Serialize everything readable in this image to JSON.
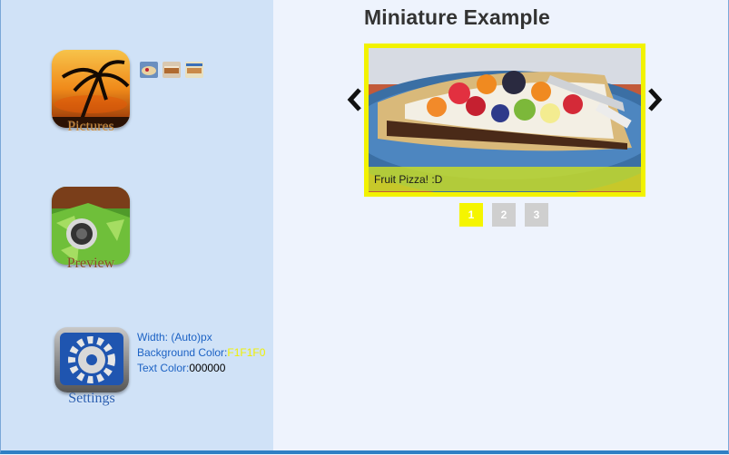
{
  "sidebar": {
    "apps": [
      {
        "label": "Pictures"
      },
      {
        "label": "Preview"
      },
      {
        "label": "Settings"
      }
    ],
    "settings": {
      "width_label": "Width:",
      "width_value": "(Auto)px",
      "background_label": "Background Color:",
      "background_value": "F1F1F0",
      "text_color_label": "Text Color:",
      "text_color_value": "000000"
    }
  },
  "main": {
    "title": "Miniature Example",
    "slide_caption": "Fruit Pizza! :D",
    "pages": [
      "1",
      "2",
      "3"
    ],
    "active_page": "1"
  },
  "colors": {
    "highlight": "#f2f200",
    "sidebar_bg": "#d0e2f7",
    "link": "#1c62c4"
  }
}
